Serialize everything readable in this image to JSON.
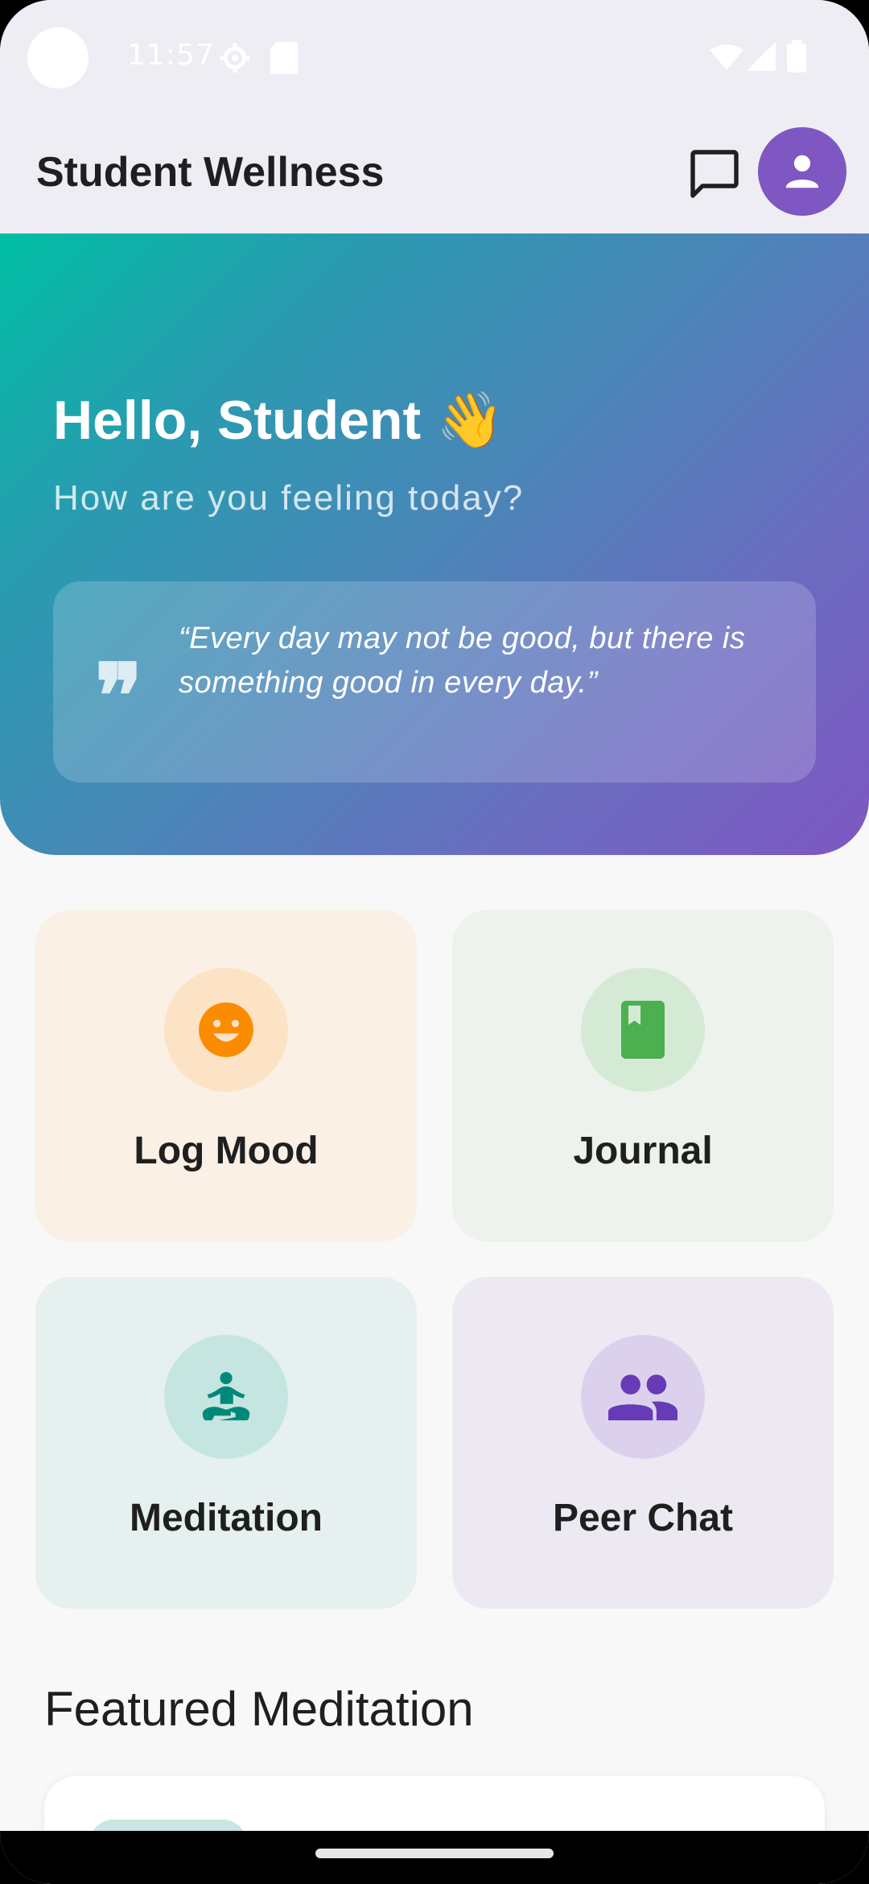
{
  "status_bar": {
    "time": "11:57",
    "icons": [
      "settings-icon",
      "sd-card-icon",
      "wifi-icon",
      "signal-icon",
      "battery-icon"
    ]
  },
  "app_bar": {
    "title": "Student Wellness",
    "actions": [
      "chat-icon",
      "profile-avatar"
    ],
    "avatar_color": "#7e57c2"
  },
  "hero": {
    "greeting": "Hello, Student 👋",
    "subtitle": "How are you feeling today?",
    "quote": "“Every day may not be good, but there is something good in every day.”",
    "gradient": [
      "#00bfa5",
      "#7e57c2"
    ]
  },
  "tiles": [
    {
      "label": "Log Mood",
      "icon": "smiley-icon",
      "color": "#fb8c00"
    },
    {
      "label": "Journal",
      "icon": "book-icon",
      "color": "#4caf50"
    },
    {
      "label": "Meditation",
      "icon": "meditation-icon",
      "color": "#00897b"
    },
    {
      "label": "Peer Chat",
      "icon": "people-icon",
      "color": "#673ab7"
    }
  ],
  "featured": {
    "section_title": "Featured Meditation"
  }
}
